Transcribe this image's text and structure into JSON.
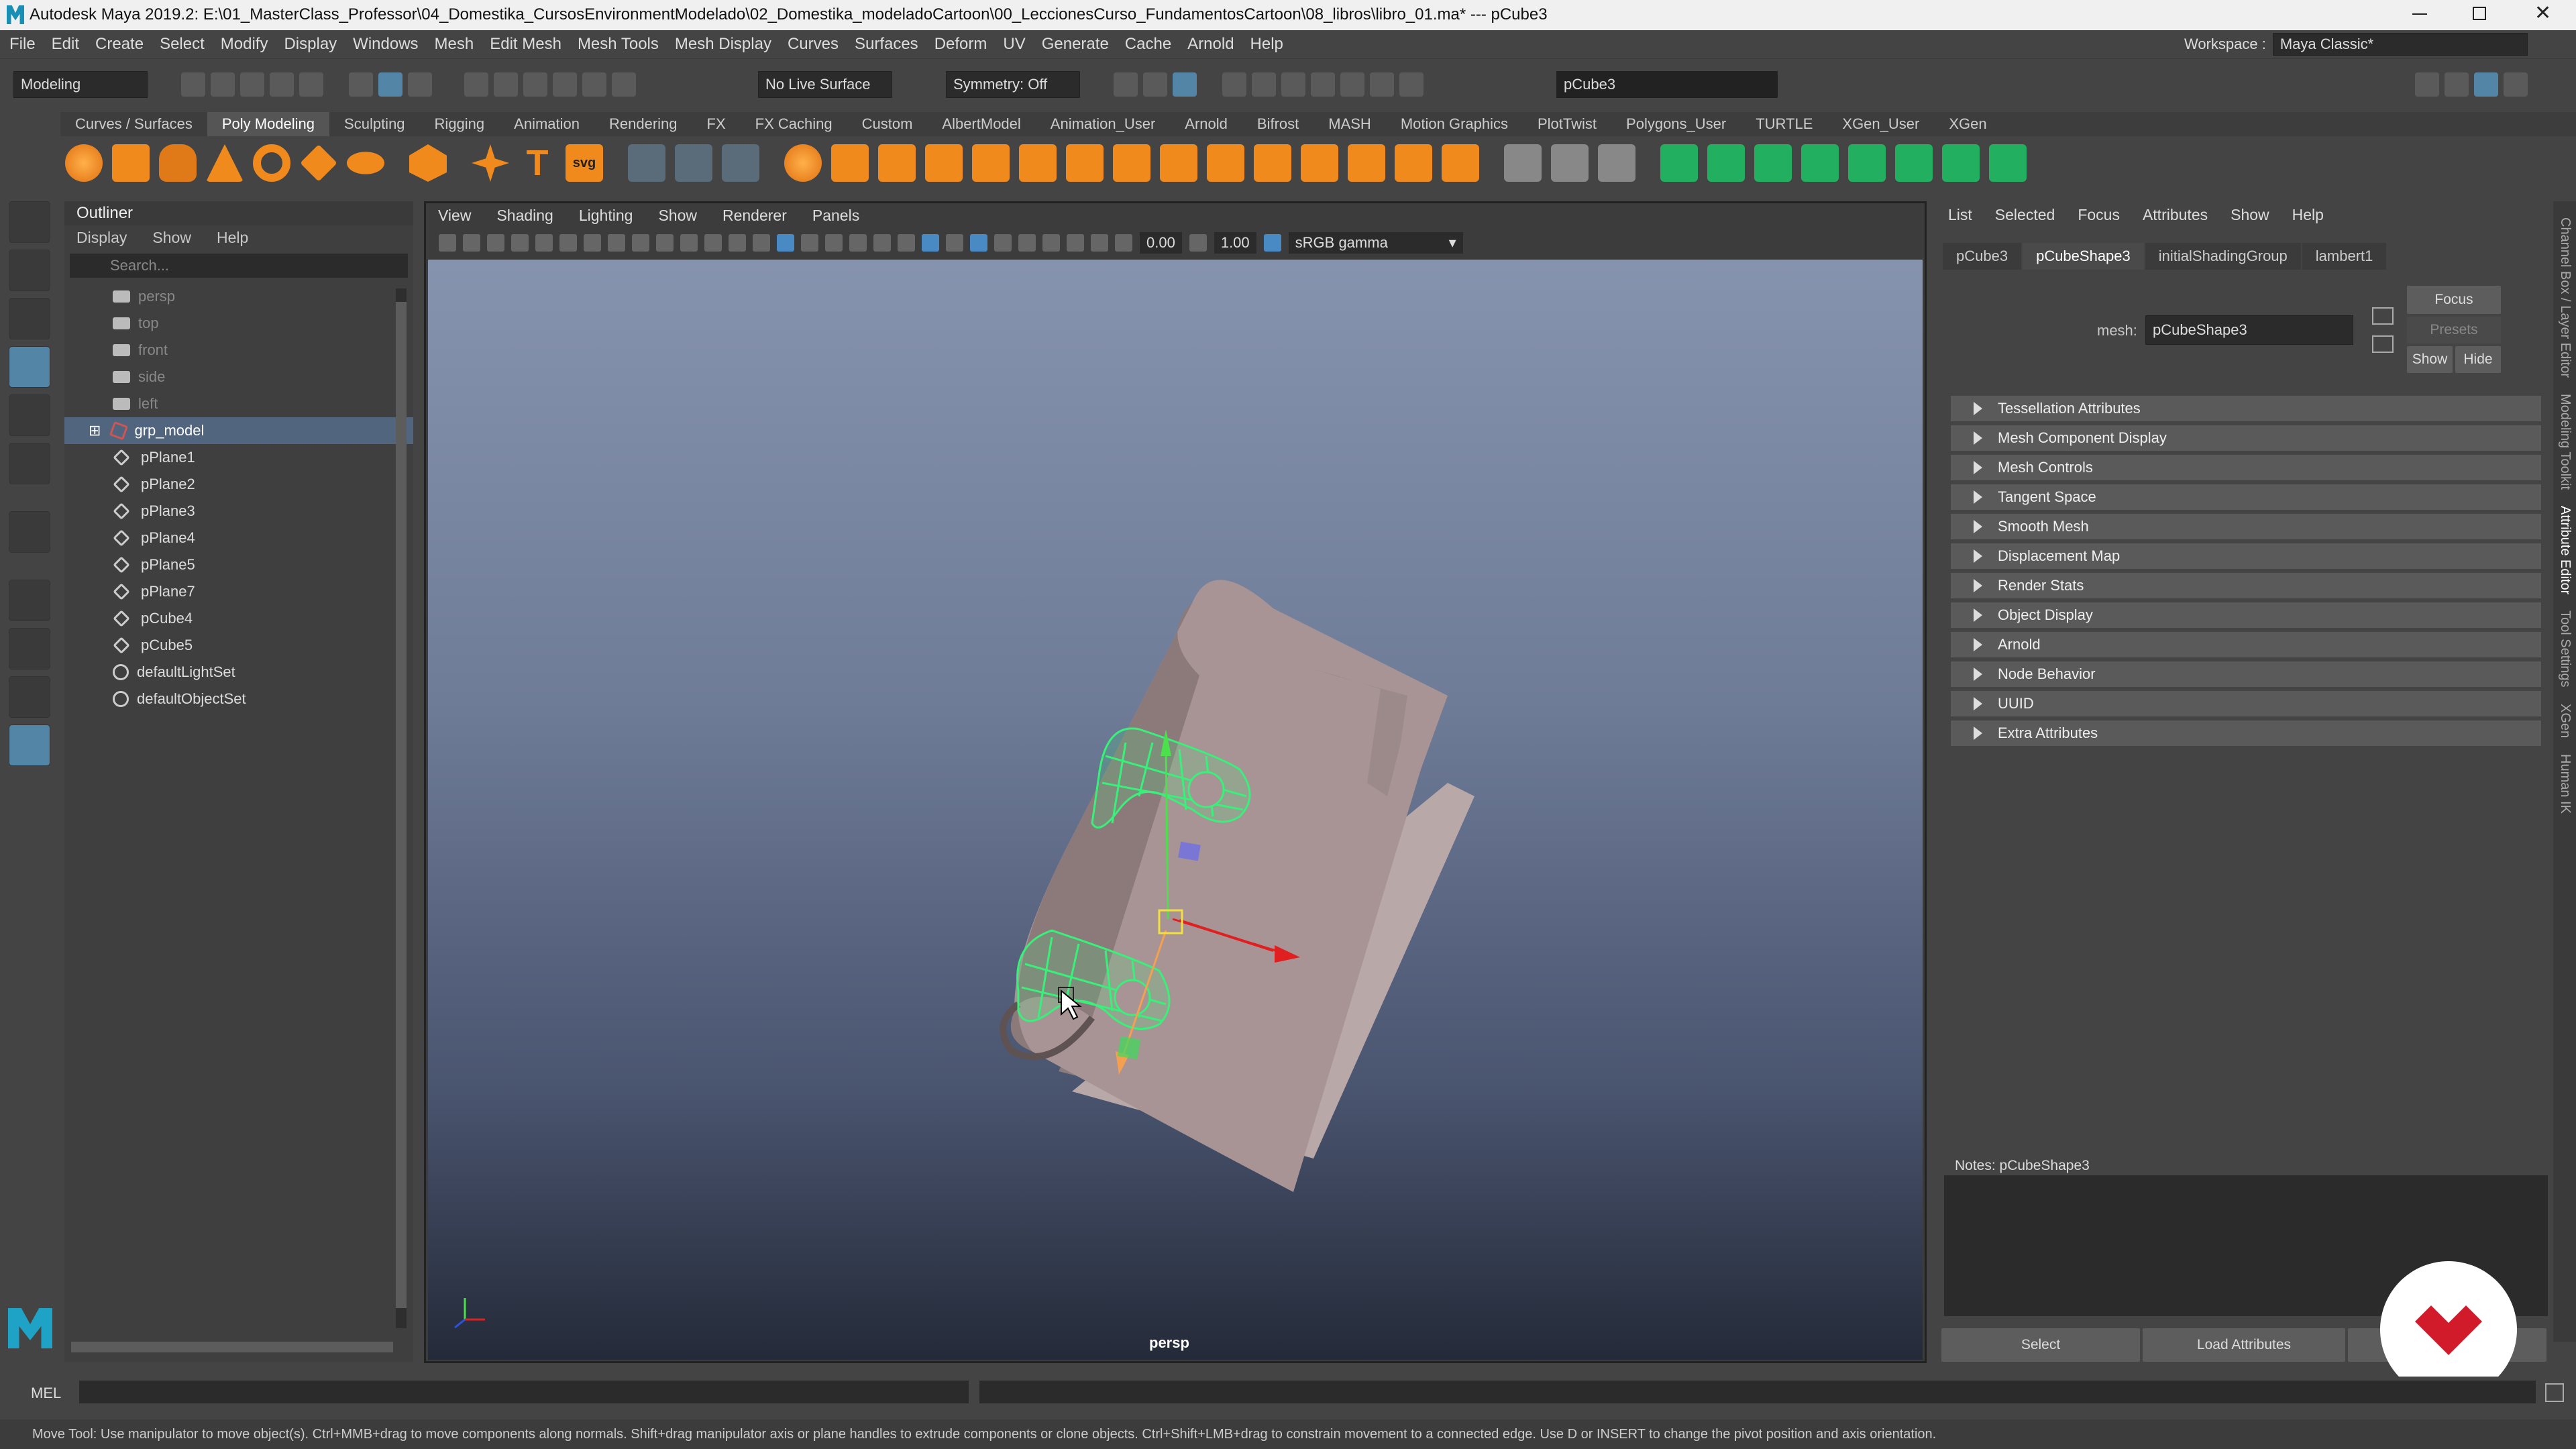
{
  "titlebar": {
    "title": "Autodesk Maya 2019.2: E:\\01_MasterClass_Professor\\04_Domestika_CursosEnvironmentModelado\\02_Domestika_modeladoCartoon\\00_LeccionesCurso_FundamentosCartoon\\08_libros\\libro_01.ma*   ---   pCube3"
  },
  "menubar": [
    "File",
    "Edit",
    "Create",
    "Select",
    "Modify",
    "Display",
    "Windows",
    "Mesh",
    "Edit Mesh",
    "Mesh Tools",
    "Mesh Display",
    "Curves",
    "Surfaces",
    "Deform",
    "UV",
    "Generate",
    "Cache",
    "Arnold",
    "Help"
  ],
  "workspace": {
    "label": "Workspace :",
    "value": "Maya Classic*"
  },
  "statusline": {
    "menuset": "Modeling",
    "live_surface": "No Live Surface",
    "symmetry": "Symmetry: Off",
    "object_field": "pCube3"
  },
  "shelf_tabs": [
    "Curves / Surfaces",
    "Poly Modeling",
    "Sculpting",
    "Rigging",
    "Animation",
    "Rendering",
    "FX",
    "FX Caching",
    "Custom",
    "AlbertModel",
    "Animation_User",
    "Arnold",
    "Bifrost",
    "MASH",
    "Motion Graphics",
    "PlotTwist",
    "Polygons_User",
    "TURTLE",
    "XGen_User",
    "XGen"
  ],
  "shelf_active": "Poly Modeling",
  "outliner": {
    "title": "Outliner",
    "menus": [
      "Display",
      "Show",
      "Help"
    ],
    "search_placeholder": "Search...",
    "items": [
      {
        "label": "persp",
        "kind": "camera"
      },
      {
        "label": "top",
        "kind": "camera"
      },
      {
        "label": "front",
        "kind": "camera"
      },
      {
        "label": "side",
        "kind": "camera"
      },
      {
        "label": "left",
        "kind": "camera"
      },
      {
        "label": "grp_model",
        "kind": "group"
      },
      {
        "label": "pPlane1",
        "kind": "mesh"
      },
      {
        "label": "pPlane2",
        "kind": "mesh"
      },
      {
        "label": "pPlane3",
        "kind": "mesh"
      },
      {
        "label": "pPlane4",
        "kind": "mesh"
      },
      {
        "label": "pPlane5",
        "kind": "mesh"
      },
      {
        "label": "pPlane7",
        "kind": "mesh"
      },
      {
        "label": "pCube4",
        "kind": "mesh"
      },
      {
        "label": "pCube5",
        "kind": "mesh"
      },
      {
        "label": "defaultLightSet",
        "kind": "set"
      },
      {
        "label": "defaultObjectSet",
        "kind": "set"
      }
    ]
  },
  "viewport": {
    "menus": [
      "View",
      "Shading",
      "Lighting",
      "Show",
      "Renderer",
      "Panels"
    ],
    "exposure": "0.00",
    "gamma": "1.00",
    "colorspace": "sRGB gamma",
    "camera_label": "persp"
  },
  "attribute_editor": {
    "menus": [
      "List",
      "Selected",
      "Focus",
      "Attributes",
      "Show",
      "Help"
    ],
    "tabs": [
      "pCube3",
      "pCubeShape3",
      "initialShadingGroup",
      "lambert1"
    ],
    "active_tab": "pCubeShape3",
    "mesh_label": "mesh:",
    "mesh_value": "pCubeShape3",
    "focus_btn": "Focus",
    "presets_btn": "Presets",
    "show_btn": "Show",
    "hide_btn": "Hide",
    "sections": [
      "Tessellation Attributes",
      "Mesh Component Display",
      "Mesh Controls",
      "Tangent Space",
      "Smooth Mesh",
      "Displacement Map",
      "Render Stats",
      "Object Display",
      "Arnold",
      "Node Behavior",
      "UUID",
      "Extra Attributes"
    ],
    "notes_label": "Notes:  pCubeShape3",
    "select_btn": "Select",
    "load_btn": "Load Attributes"
  },
  "side_tabs": [
    "Channel Box / Layer Editor",
    "Modeling Toolkit",
    "Attribute Editor",
    "Tool Settings",
    "XGen",
    "Human IK"
  ],
  "commandline": {
    "lang": "MEL"
  },
  "helpline": "Move Tool: Use manipulator to move object(s). Ctrl+MMB+drag to move components along normals. Shift+drag manipulator axis or plane handles to extrude components or clone objects. Ctrl+Shift+LMB+drag to constrain movement to a connected edge. Use D or INSERT to change the pivot position and axis orientation."
}
